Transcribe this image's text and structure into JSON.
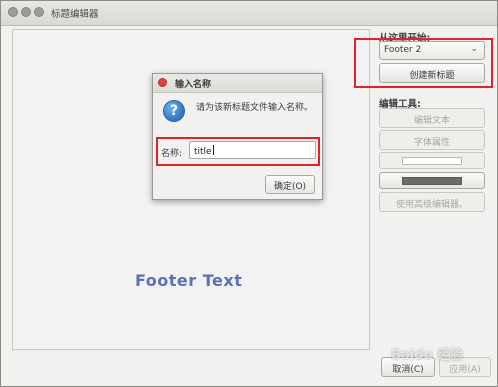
{
  "window": {
    "title": "标题编辑器"
  },
  "preview": {
    "footer_text": "Footer Text"
  },
  "sidebar": {
    "start_label": "从这里开始:",
    "combo_value": "Footer 2",
    "create_button": "创建新标题",
    "edit_tools_label": "编辑工具:",
    "edit_text_button": "编辑文本",
    "font_props_button": "字体属性",
    "advanced_button": "使用高级编辑器。"
  },
  "dialog": {
    "title": "输入名称",
    "message": "请为该新标题文件输入名称。",
    "field_label": "名称:",
    "field_value": "title",
    "ok_button": "确定(O)"
  },
  "footer_buttons": {
    "cancel": "取消(C)",
    "apply": "应用(A)"
  },
  "watermark": "Baidu 经验",
  "colors": {
    "highlight_box": "#e0232b",
    "footer_text": "#5f6fb5",
    "close_button": "#e0453a"
  }
}
